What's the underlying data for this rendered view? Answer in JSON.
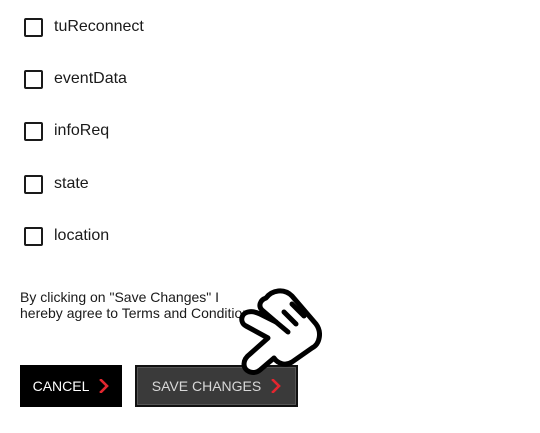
{
  "options": [
    {
      "label": "tuReconnect",
      "checked": false
    },
    {
      "label": "eventData",
      "checked": false
    },
    {
      "label": "infoReq",
      "checked": false
    },
    {
      "label": "state",
      "checked": false
    },
    {
      "label": "location",
      "checked": false
    }
  ],
  "consent_text": "By clicking on \"Save Changes\" I hereby agree to Terms and Conditions",
  "buttons": {
    "cancel_label": "CANCEL",
    "save_label": "SAVE CHANGES"
  },
  "icons": {
    "chevron": "chevron-right-icon",
    "pointer": "pointing-hand-icon"
  },
  "colors": {
    "accent_chevron": "#e3262f",
    "cancel_bg": "#000000",
    "save_bg": "#3a3a3a"
  }
}
